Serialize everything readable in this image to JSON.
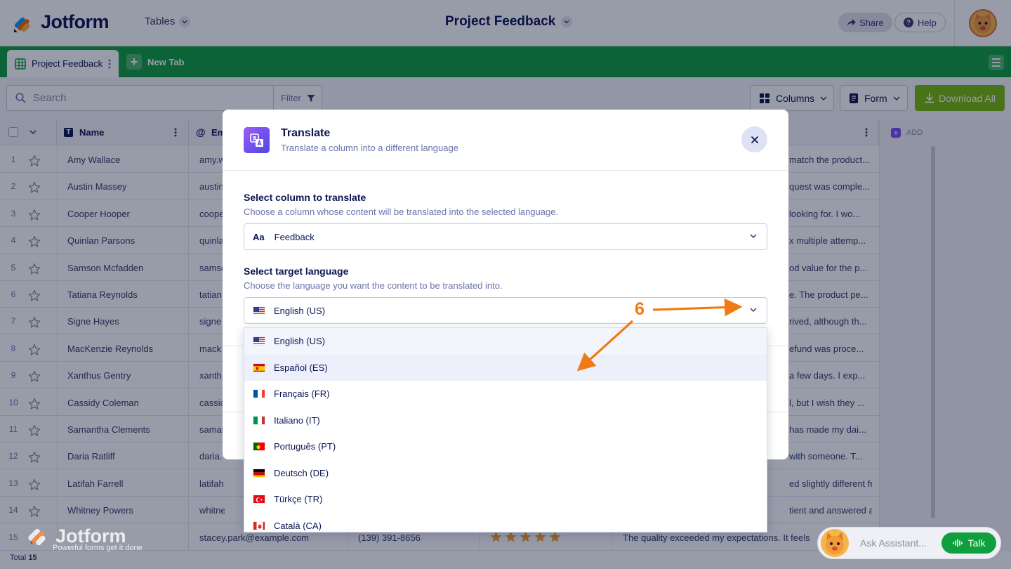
{
  "header": {
    "logo_text": "Jotform",
    "tables_label": "Tables",
    "title": "Project Feedback",
    "share_label": "Share",
    "help_label": "Help"
  },
  "tabs": {
    "active_label": "Project Feedback",
    "new_tab_label": "New Tab"
  },
  "toolbar": {
    "search_placeholder": "Search",
    "filter_label": "Filter",
    "columns_label": "Columns",
    "form_label": "Form",
    "download_label": "Download All"
  },
  "table": {
    "col_name": "Name",
    "col_email_partial": "Em",
    "add_label": "ADD",
    "rows": [
      {
        "num": "1",
        "name": "Amy Wallace",
        "email": "amy.w",
        "feedback": "match the product..."
      },
      {
        "num": "2",
        "name": "Austin Massey",
        "email": "austin",
        "feedback": "quest was comple..."
      },
      {
        "num": "3",
        "name": "Cooper Hooper",
        "email": "coope",
        "feedback": "looking for. I wo..."
      },
      {
        "num": "4",
        "name": "Quinlan Parsons",
        "email": "quinla",
        "feedback": "x multiple attemp..."
      },
      {
        "num": "5",
        "name": "Samson Mcfadden",
        "email": "samso",
        "feedback": "od value for the p..."
      },
      {
        "num": "6",
        "name": "Tatiana Reynolds",
        "email": "tatian",
        "feedback": "e. The product pe..."
      },
      {
        "num": "7",
        "name": "Signe Hayes",
        "email": "signe",
        "feedback": "rived, although th..."
      },
      {
        "num": "8",
        "name": "MacKenzie Reynolds",
        "email": "mack",
        "feedback": "efund was proce..."
      },
      {
        "num": "9",
        "name": "Xanthus Gentry",
        "email": "xanth",
        "feedback": "a few days. I exp..."
      },
      {
        "num": "10",
        "name": "Cassidy Coleman",
        "email": "cassic",
        "feedback": "l, but I wish they ..."
      },
      {
        "num": "11",
        "name": "Samantha Clements",
        "email": "saman",
        "feedback": "has made my dai..."
      },
      {
        "num": "12",
        "name": "Daria Ratliff",
        "email": "daria.",
        "feedback": "with someone. T..."
      },
      {
        "num": "13",
        "name": "Latifah Farrell",
        "email": "latifah.farr",
        "feedback": "ed slightly different fr..."
      },
      {
        "num": "14",
        "name": "Whitney Powers",
        "email": "whitney.po",
        "feedback": "tient and answered all ..."
      }
    ],
    "row15": {
      "num": "15",
      "email": "stacey.park@example.com",
      "phone": "(139) 391-8656",
      "feedback": "The quality exceeded my expectations. It feels"
    },
    "total_label": "Total",
    "total_count": "15"
  },
  "modal": {
    "title": "Translate",
    "subtitle": "Translate a column into a different language",
    "column_label": "Select column to translate",
    "column_help": "Choose a column whose content will be translated into the selected language.",
    "column_value": "Feedback",
    "column_type_glyph": "Aa",
    "language_label": "Select target language",
    "language_help": "Choose the language you want the content to be translated into.",
    "language_value": "English (US)",
    "options": [
      "English (US)",
      "Español (ES)",
      "Français (FR)",
      "Italiano (IT)",
      "Português (PT)",
      "Deutsch (DE)",
      "Türkçe (TR)",
      "Català (CA)"
    ]
  },
  "annotation": {
    "step_number": "6",
    "color": "#f07b14"
  },
  "assistant": {
    "placeholder": "Ask Assistant...",
    "talk_label": "Talk"
  },
  "watermark": {
    "text": "Jotform",
    "tagline": "Powerful forms get it done"
  },
  "colors": {
    "brand_green": "#0f9f3d",
    "download_green": "#78bb07",
    "navy": "#0a1551",
    "translate_purple": "#7c4dff"
  }
}
